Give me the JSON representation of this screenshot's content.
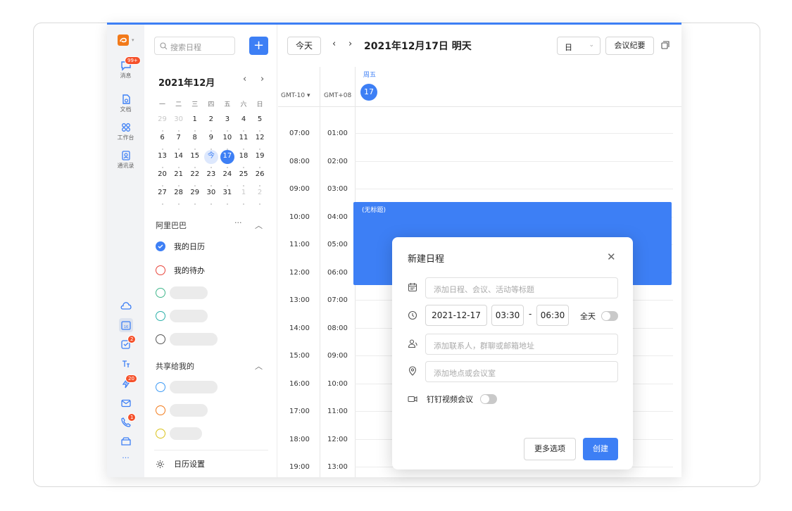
{
  "rail": {
    "items": [
      {
        "label": "消息",
        "badge": "99+"
      },
      {
        "label": "文档"
      },
      {
        "label": "工作台"
      },
      {
        "label": "通讯录"
      }
    ],
    "bottom_badges": [
      "2",
      "20",
      "1"
    ]
  },
  "sidebar": {
    "search_placeholder": "搜索日程",
    "add_label": "+",
    "month_title": "2021年12月",
    "weekdays": [
      "一",
      "二",
      "三",
      "四",
      "五",
      "六",
      "日"
    ],
    "weeks": [
      [
        "29",
        "30",
        "1",
        "2",
        "3",
        "4",
        "5"
      ],
      [
        "6",
        "7",
        "8",
        "9",
        "10",
        "11",
        "12"
      ],
      [
        "13",
        "14",
        "15",
        "今",
        "17",
        "18",
        "19"
      ],
      [
        "20",
        "21",
        "22",
        "23",
        "24",
        "25",
        "26"
      ],
      [
        "27",
        "28",
        "29",
        "30",
        "31",
        "1",
        "2"
      ]
    ],
    "group1_title": "阿里巴巴",
    "group1_more": "···",
    "my_calendar": "我的日历",
    "my_todo": "我的待办",
    "group2_title": "共享给我的",
    "settings": "日历设置",
    "colors": {
      "blue": "#3d7ff5",
      "red": "#e8443a",
      "green": "#3fb68b",
      "teal": "#2bb0a9",
      "gray": "#555555",
      "blue2": "#3d9af5",
      "orange": "#f27a1a",
      "yellow": "#d9c21a"
    }
  },
  "main": {
    "today_btn": "今天",
    "prev": "‹",
    "next": "›",
    "date_title": "2021年12月17日 明天",
    "view_select": "日",
    "meeting_minutes": "会议纪要",
    "weekday": "周五",
    "day_number": "17",
    "tz_left": "GMT-10 ▾",
    "tz_right": "GMT+08",
    "times_left": [
      "07:00",
      "08:00",
      "09:00",
      "10:00",
      "11:00",
      "12:00",
      "13:00",
      "14:00",
      "15:00",
      "16:00",
      "17:00",
      "18:00",
      "19:00"
    ],
    "times_right": [
      "01:00",
      "02:00",
      "03:00",
      "04:00",
      "05:00",
      "06:00",
      "07:00",
      "08:00",
      "09:00",
      "10:00",
      "11:00",
      "12:00",
      "13:00"
    ],
    "event_title": "(无标题)"
  },
  "dialog": {
    "title": "新建日程",
    "close": "✕",
    "title_placeholder": "添加日程、会议、活动等标题",
    "date": "2021-12-17",
    "start_time": "03:30",
    "dash": "-",
    "end_time": "06:30",
    "all_day": "全天",
    "attendees_placeholder": "添加联系人，群聊或邮箱地址",
    "location_placeholder": "添加地点或会议室",
    "video_label": "钉钉视频会议",
    "more_options": "更多选项",
    "create": "创建"
  }
}
